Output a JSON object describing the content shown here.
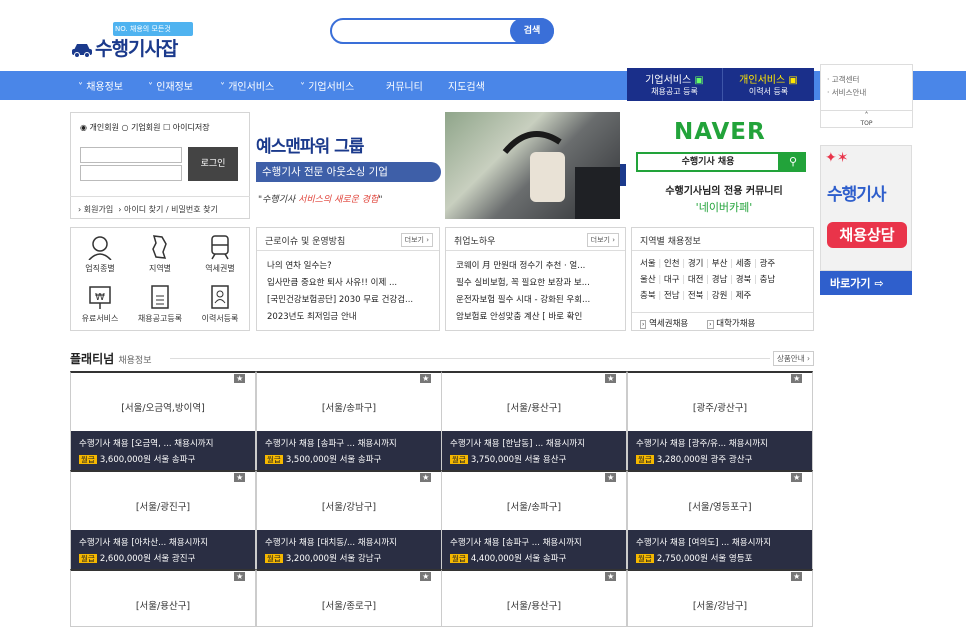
{
  "header": {
    "logo_sub": "NO. 채용의 모든것",
    "logo_main": "수행기사잡",
    "search_button": "검색",
    "search_value": ""
  },
  "nav": {
    "items": [
      "채용정보",
      "인재정보",
      "개인서비스",
      "기업서비스",
      "커뮤니티",
      "지도검색"
    ],
    "biz_title": "기업서비스",
    "biz_sub": "채용공고 등록",
    "ind_title": "개인서비스",
    "ind_sub": "이력서 등록"
  },
  "side_menu": {
    "items": [
      "· 고객센터",
      "· 서비스안내"
    ],
    "top": "TOP"
  },
  "login": {
    "radio_personal": "개인회원",
    "radio_company": "기업회원",
    "save_id": "아이디저장",
    "login_button": "로그인",
    "link_join": "회원가입",
    "link_find": "아이디 찾기 / 비밀번호 찾기"
  },
  "quick": {
    "items": [
      "업직종별",
      "지역별",
      "역세권별",
      "유료서비스",
      "채용공고등록",
      "이력서등록"
    ]
  },
  "banner": {
    "headline": "예스맨파워 그룹",
    "tag": "수행기사 전문 아웃소싱 기업",
    "slogan_a": "\"수행기사 ",
    "slogan_b": "서비스의 새로운 경험",
    "slogan_c": "\""
  },
  "naver": {
    "brand": "NAVER",
    "query": "수행기사 채용",
    "line1": "수행기사님의 전용 커뮤니티",
    "line2": "'네이버카페'"
  },
  "right_banner": {
    "title": "수행기사",
    "sub": "채용상담",
    "button": "바로가기"
  },
  "panels": {
    "labor": {
      "title": "근로이슈 및 운영방침",
      "more": "더보기",
      "items": [
        "나의 연차 일수는?",
        "입사만큼 중요한 퇴사 사유!! 이제 ...",
        "[국민건강보험공단] 2030 무료 건강검...",
        "2023년도 최저임금 안내"
      ]
    },
    "job": {
      "title": "취업노하우",
      "more": "더보기",
      "items": [
        "코웨이 月 만원대 정수기 추천 · 얼...",
        "필수 실비보험, 꼭 필요한 보장과 보...",
        "운전자보험 필수 시대 - 강화된 우회...",
        "암보험료 안성맞춤 계산 [ 바로 확인"
      ]
    },
    "region": {
      "title": "지역별 채용정보",
      "rows": [
        [
          "서울",
          "인천",
          "경기",
          "부산",
          "세종",
          "광주"
        ],
        [
          "울산",
          "대구",
          "대전",
          "경남",
          "경북",
          "충남"
        ],
        [
          "충북",
          "전남",
          "전북",
          "강원",
          "제주"
        ]
      ],
      "btn_station": "역세권채용",
      "btn_univ": "대학가채용"
    }
  },
  "platinum": {
    "title": "플래티넘",
    "subtitle": "채용정보",
    "more": "상품안내",
    "pay_label": "월급",
    "cards": [
      {
        "loc": "[서울/오금역,방이역]",
        "title": "수행기사 채용 [오금역, ... 채용시까지",
        "pay": "3,600,000원 서울 송파구"
      },
      {
        "loc": "[서울/송파구]",
        "title": "수행기사 채용 [송파구 ... 채용시까지",
        "pay": "3,500,000원 서울 송파구"
      },
      {
        "loc": "[서울/용산구]",
        "title": "수행기사 채용 [한남동] ... 채용시까지",
        "pay": "3,750,000원 서울 용산구"
      },
      {
        "loc": "[광주/광산구]",
        "title": "수행기사 채용 [광주/유... 채용시까지",
        "pay": "3,280,000원 광주 광산구"
      },
      {
        "loc": "[서울/광진구]",
        "title": "수행기사 채용 [아차산... 채용시까지",
        "pay": "2,600,000원 서울 광진구"
      },
      {
        "loc": "[서울/강남구]",
        "title": "수행기사 채용 [대치동/... 채용시까지",
        "pay": "3,200,000원 서울 강남구"
      },
      {
        "loc": "[서울/송파구]",
        "title": "수행기사 채용 [송파구 ... 채용시까지",
        "pay": "4,400,000원 서울 송파구"
      },
      {
        "loc": "[서울/영등포구]",
        "title": "수행기사 채용 [여의도] ... 채용시까지",
        "pay": "2,750,000원 서울 영등포"
      },
      {
        "loc": "[서울/용산구]"
      },
      {
        "loc": "[서울/종로구]"
      },
      {
        "loc": "[서울/용산구]"
      },
      {
        "loc": "[서울/강남구]"
      }
    ]
  },
  "colors": {
    "nav_blue": "#4a86e8",
    "dark_navy": "#1a2f8a",
    "card_bar": "#2a2e43",
    "pay_badge": "#f5b800"
  }
}
